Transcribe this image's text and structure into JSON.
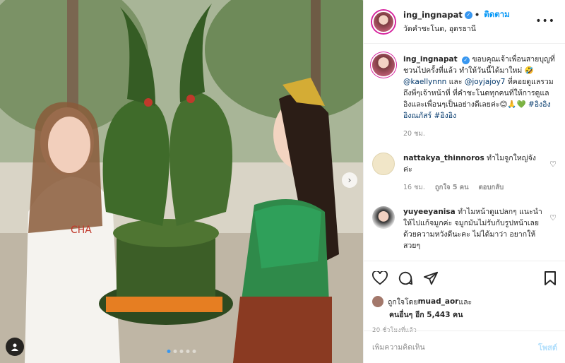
{
  "post": {
    "media_label": "",
    "carousel_count": 5,
    "carousel_active": 0
  },
  "header": {
    "username": "ing_ingnapat",
    "separator": "•",
    "follow_label": "ติดตาม",
    "location": "วัดคำชะโนด, อุดรธานี",
    "more_icon": "more-horizontal-icon"
  },
  "caption": {
    "username": "ing_ingnapat",
    "text_part1": "ขอบคุณเจ้าเพื่อนสายบุญที่ชวนไปครั้งที่แล้ว ทำให้วันนี้ได้มาใหม่ 🤣 ",
    "mention1": "@kaellynnn",
    "text_part2": " และ ",
    "mention2": "@joyjajoy7",
    "text_part3": " ที่คอยดูแลรวมถึงพี่ๆเจ้าหน้าที่ ที่คำชะโนดทุกคนที่ให้การดูแลอิงและเพื่อนๆเป็นอย่างดีเลยค่ะ😊🙏💚 ",
    "hashtags": "#อิงอิงอิงณภัสร์ #อิงอิง",
    "time": "20 ชม."
  },
  "comments": [
    {
      "username": "nattakya_thinnoros",
      "text": "ทำไมจูกใหญ่จังค่ะ",
      "time": "16 ชม.",
      "likes": "ถูกใจ 5 คน",
      "reply": "ตอบกลับ"
    },
    {
      "username": "yuyeeyanisa",
      "text": "ทำไมหน้าดูแปลกๆ แนะนำให้ไปแก้จมูกค่ะ จมูกมันไม่รับกับรูปหน้าเลย ด้วยความหวังดีนะคะ ไม่ได้มาว่า อยากให้สวยๆ",
      "time": "",
      "likes": "",
      "reply": ""
    }
  ],
  "actions": {
    "like_icon": "heart-icon",
    "comment_icon": "comment-icon",
    "share_icon": "share-icon",
    "save_icon": "bookmark-icon"
  },
  "likes": {
    "prefix": "ถูกใจโดย ",
    "user": "muad_aor",
    "middle": " และ",
    "others": "คนอื่นๆ อีก 5,443 คน"
  },
  "timestamp": "20 ชั่วโมงที่แล้ว",
  "add_comment": {
    "placeholder": "เพิ่มความคิดเห็น",
    "post_label": "โพสต์"
  },
  "colors": {
    "accent": "#0095f6",
    "verified": "#3897f0",
    "mention": "#00376b"
  }
}
